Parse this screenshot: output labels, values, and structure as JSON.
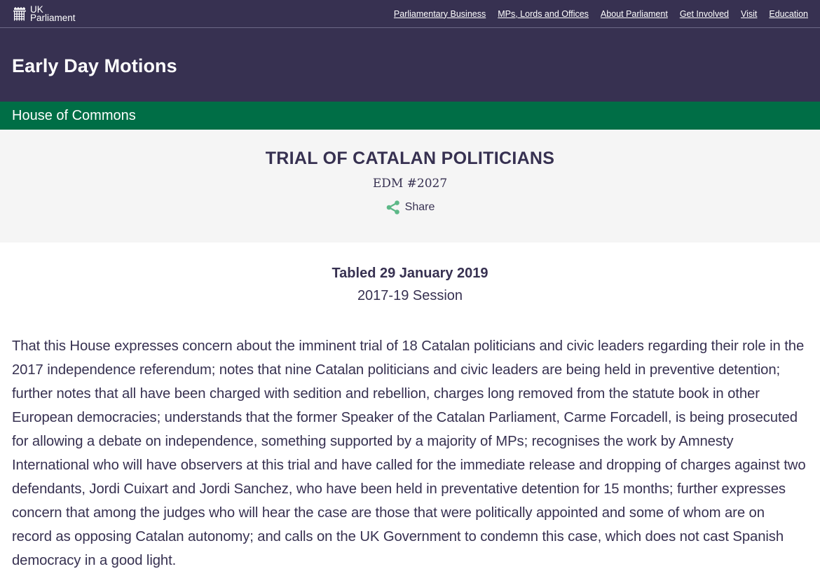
{
  "topbar": {
    "logo": {
      "line1": "UK",
      "line2": "Parliament"
    },
    "nav": [
      {
        "label": "Parliamentary Business"
      },
      {
        "label": "MPs, Lords and Offices"
      },
      {
        "label": "About Parliament"
      },
      {
        "label": "Get Involved"
      },
      {
        "label": "Visit"
      },
      {
        "label": "Education"
      }
    ]
  },
  "hero": {
    "title": "Early Day Motions"
  },
  "house": {
    "label": "House of Commons"
  },
  "motion": {
    "title": "TRIAL OF CATALAN POLITICIANS",
    "number": "EDM #2027",
    "share_label": "Share",
    "share_icon": "share-icon",
    "tabled": "Tabled 29 January 2019",
    "session": "2017-19 Session",
    "text": "That this House expresses concern about the imminent trial of 18 Catalan politicians and civic leaders regarding their role in the 2017 independence referendum; notes that nine Catalan politicians and civic leaders are being held in preventive detention; further notes that all have been charged with sedition and rebellion, charges long removed from the statute book in other European democracies; understands that the former Speaker of the Catalan Parliament, Carme Forcadell, is being prosecuted for allowing a debate on independence, something supported by a majority of MPs; recognises the work by Amnesty International who will have observers at this trial and have called for the immediate release and dropping of charges against two defendants, Jordi Cuixart and Jordi Sanchez, who have been held in preventative detention for 15 months; further expresses concern that among the judges who will hear the case are those that were politically appointed and some of whom are on record as opposing Catalan autonomy; and calls on the UK Government to condemn this case, which does not cast Spanish democracy in a good light."
  },
  "colors": {
    "brand_purple": "#373151",
    "commons_green": "#006e46",
    "share_green": "#5cb887",
    "panel_grey": "#f5f5f5"
  }
}
